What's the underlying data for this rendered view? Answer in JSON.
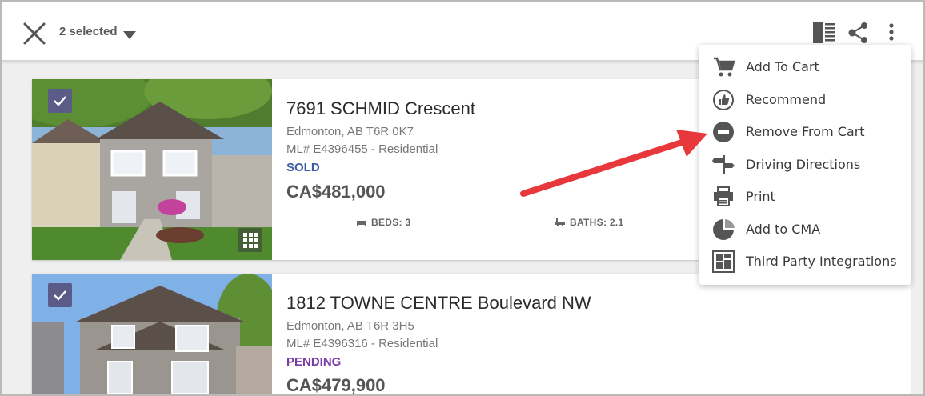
{
  "toolbar": {
    "selected_text": "2 selected"
  },
  "menu": {
    "items": [
      {
        "label": "Add To Cart",
        "icon": "cart-icon"
      },
      {
        "label": "Recommend",
        "icon": "thumbs-up-icon"
      },
      {
        "label": "Remove From Cart",
        "icon": "remove-circle-icon"
      },
      {
        "label": "Driving Directions",
        "icon": "signpost-icon"
      },
      {
        "label": "Print",
        "icon": "printer-icon"
      },
      {
        "label": "Add to CMA",
        "icon": "pie-chart-icon"
      },
      {
        "label": "Third Party Integrations",
        "icon": "dashboard-icon"
      }
    ]
  },
  "listings": [
    {
      "address": "7691 SCHMID Crescent",
      "city": "Edmonton, AB T6R 0K7",
      "mls": "ML# E4396455 - Residential",
      "status": "SOLD",
      "status_color": "#3b5ba9",
      "price": "CA$481,000",
      "beds": "BEDS: 3",
      "baths": "BATHS: 2.1",
      "checked": true
    },
    {
      "address": "1812 TOWNE CENTRE Boulevard NW",
      "city": "Edmonton, AB T6R 3H5",
      "mls": "ML# E4396316 - Residential",
      "status": "PENDING",
      "status_color": "#7a3aa8",
      "price": "CA$479,900",
      "checked": true
    }
  ],
  "colors": {
    "checkbox": "#5b5b88",
    "arrow": "#e8383b"
  }
}
